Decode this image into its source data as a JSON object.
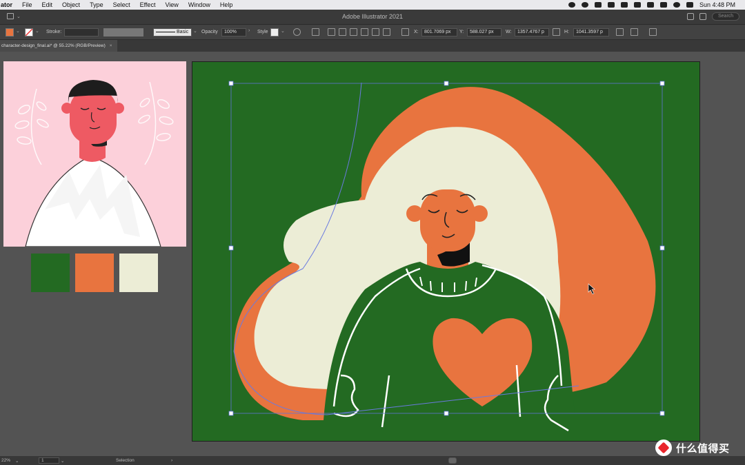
{
  "menubar": {
    "app_name": "ator",
    "items": [
      "File",
      "Edit",
      "Object",
      "Type",
      "Select",
      "Effect",
      "View",
      "Window",
      "Help"
    ],
    "clock": "Sun 4:48 PM"
  },
  "titlebar": {
    "title": "Adobe Illustrator 2021",
    "search_placeholder": "Search"
  },
  "controlbar": {
    "stroke_label": "Stroke:",
    "brush_label": "Basic",
    "opacity_label": "Opacity",
    "opacity_value": "100%",
    "style_label": "Style",
    "x_label": "X:",
    "x_value": "801.7069 px",
    "y_label": "Y:",
    "y_value": "588.027 px",
    "w_label": "W:",
    "w_value": "1357.4767 p",
    "h_label": "H:",
    "h_value": "1041.3597 p",
    "fill_color": "#e8743f"
  },
  "document": {
    "tab_label": "character-design_final.ai* @ 55.22% (RGB/Preview)",
    "tab_close": "×"
  },
  "palette": {
    "green": "#236a22",
    "orange": "#e8743f",
    "cream": "#ecedd6"
  },
  "statusbar": {
    "zoom": "22%",
    "artboard_number": "1",
    "tool_name": "Selection"
  },
  "watermark": {
    "text": "什么值得买"
  }
}
